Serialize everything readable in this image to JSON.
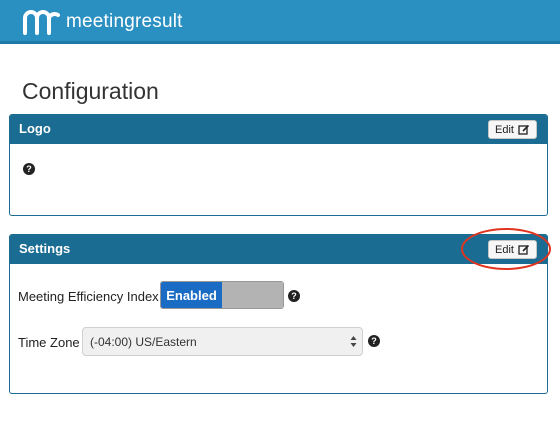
{
  "header": {
    "brand_name": "meetingresult",
    "logo_icon": "mr-logo-icon",
    "brand_color": "#2a8fc1"
  },
  "page": {
    "title": "Configuration"
  },
  "logo_panel": {
    "title": "Logo",
    "edit_label": "Edit",
    "help_icon": "question-circle-icon"
  },
  "settings_panel": {
    "title": "Settings",
    "edit_label": "Edit",
    "rows": [
      {
        "label": "Meeting Efficiency Index",
        "control": "toggle",
        "value": "Enabled",
        "state": "on"
      },
      {
        "label": "Time Zone",
        "control": "select",
        "value": "(-04:00) US/Eastern"
      }
    ]
  },
  "colors": {
    "panel_header": "#1b6c92",
    "toggle_on": "#1a6bc4",
    "annotation": "#e0341f"
  }
}
